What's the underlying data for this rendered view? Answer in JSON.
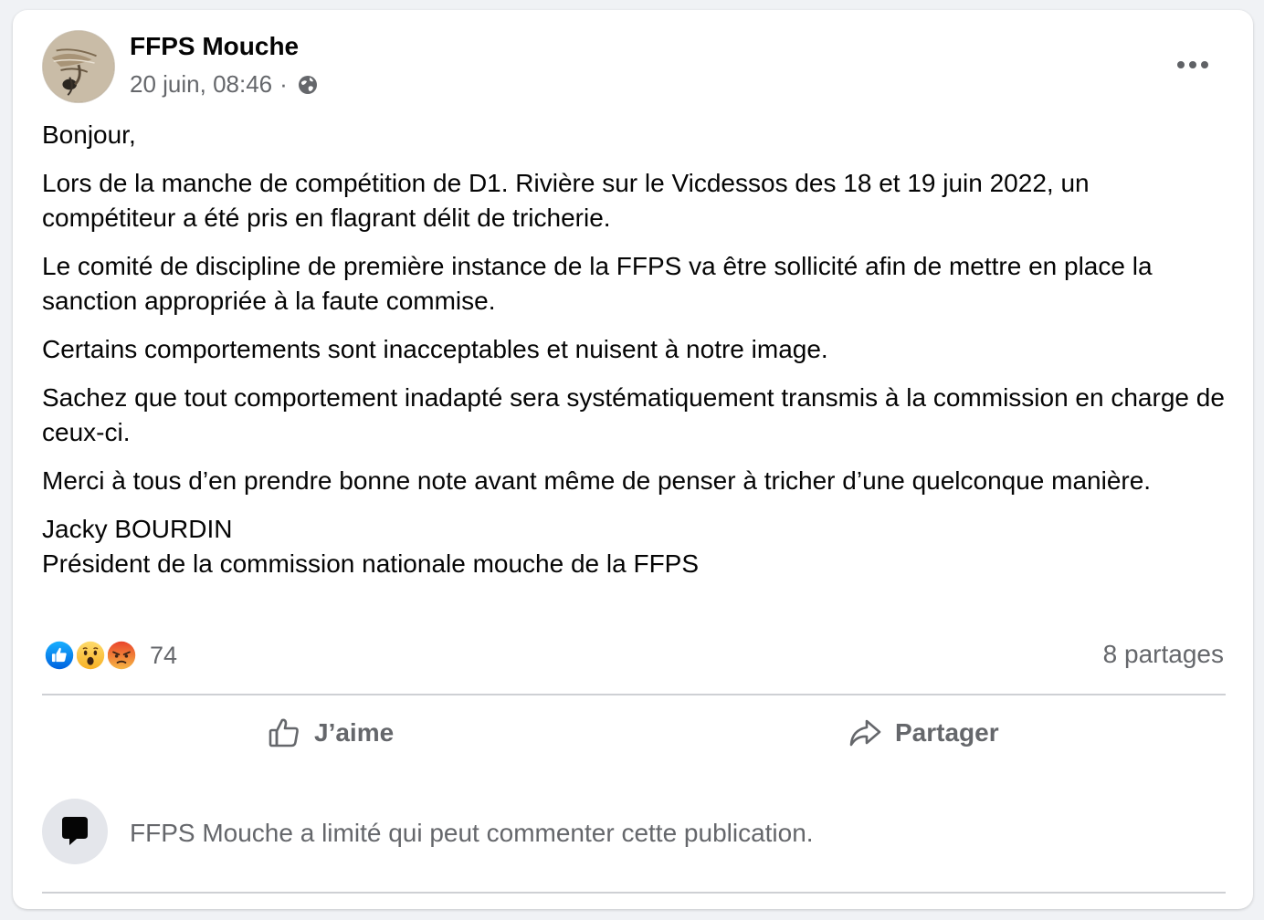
{
  "post": {
    "author": "FFPS Mouche",
    "timestamp": "20 juin, 08:46",
    "meta_separator": "·",
    "audience_icon": "globe-icon",
    "more_icon": "more-options-icon",
    "paragraphs": [
      "Bonjour,",
      "Lors de la manche de compétition de D1. Rivière sur le Vicdessos des 18 et 19 juin 2022, un compétiteur a été pris en flagrant délit de tricherie.",
      "Le comité de discipline de première instance de la FFPS va être sollicité afin de mettre en place la sanction appropriée à la faute commise.",
      "Certains comportements sont inacceptables et nuisent à notre image.",
      "Sachez que tout comportement inadapté sera systématiquement transmis à la commission en charge de ceux-ci.",
      "Merci à tous d’en prendre bonne note avant même de penser à tricher d’une quelconque manière.",
      "Jacky BOURDIN\nPrésident de la commission nationale mouche de la FFPS"
    ]
  },
  "reactions": {
    "types": [
      "like",
      "wow",
      "angry"
    ],
    "count": "74",
    "shares": "8 partages"
  },
  "actions": {
    "like_label": "J’aime",
    "share_label": "Partager"
  },
  "comments": {
    "notice": "FFPS Mouche a limité qui peut commenter cette publication."
  },
  "colors": {
    "like_blue": "#1877f2",
    "secondary_text": "#65676b",
    "divider": "#ced0d4"
  }
}
